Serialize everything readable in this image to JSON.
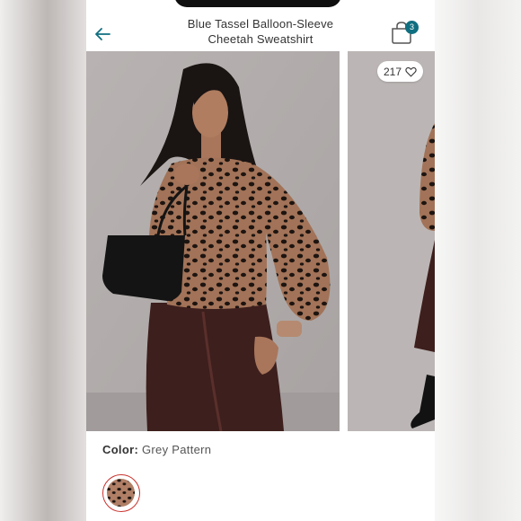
{
  "header": {
    "title": "Blue Tassel Balloon-Sleeve Cheetah Sweatshirt",
    "bag_count": "3"
  },
  "gallery": {
    "favorite_count": "217"
  },
  "color": {
    "label": "Color:",
    "value": "Grey Pattern"
  },
  "icons": {
    "back": "arrow-left-icon",
    "bag": "shopping-bag-icon",
    "favorite": "heart-outline-icon"
  },
  "colors": {
    "accent": "#0f6f80",
    "swatch_ring": "#c9312b"
  }
}
